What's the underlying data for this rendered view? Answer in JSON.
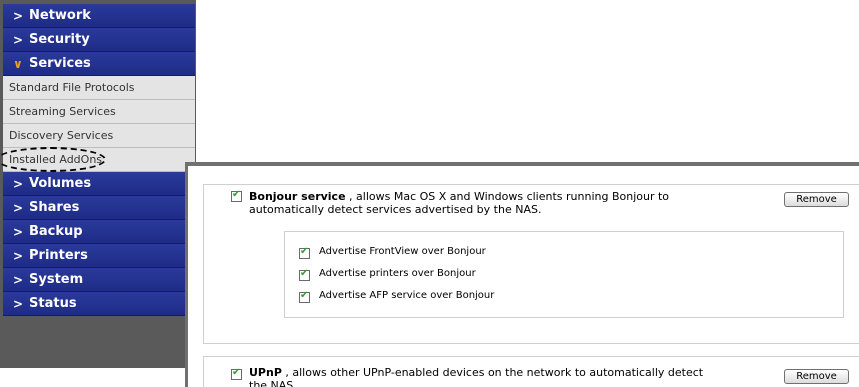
{
  "sidebar": {
    "menu_top": [
      {
        "label": "Network",
        "expanded": false
      },
      {
        "label": "Security",
        "expanded": false
      },
      {
        "label": "Services",
        "expanded": true
      }
    ],
    "submenu": [
      {
        "label": "Standard File Protocols"
      },
      {
        "label": "Streaming Services"
      },
      {
        "label": "Discovery Services",
        "highlighted": true
      },
      {
        "label": "Installed AddOns"
      }
    ],
    "menu_bottom": [
      {
        "label": "Volumes"
      },
      {
        "label": "Shares"
      },
      {
        "label": "Backup"
      },
      {
        "label": "Printers"
      },
      {
        "label": "System"
      },
      {
        "label": "Status"
      }
    ],
    "collapsed_icon": "chevron-right-icon",
    "expanded_icon": "chevron-down-icon",
    "colors": {
      "nav_bg": "#1e2c86",
      "expanded_icon": "#e8a020",
      "submenu_bg": "#e4e4e4"
    }
  },
  "services": [
    {
      "name": "Bonjour service",
      "description": ", allows Mac OS X and Windows clients running Bonjour to automatically detect services advertised by the NAS.",
      "checked": true,
      "remove_label": "Remove",
      "options": [
        {
          "label": "Advertise FrontView over Bonjour",
          "checked": true
        },
        {
          "label": "Advertise printers over Bonjour",
          "checked": true
        },
        {
          "label": "Advertise AFP service over Bonjour",
          "checked": true
        }
      ]
    },
    {
      "name": "UPnP",
      "description": ", allows other UPnP-enabled devices on the network to automatically detect the NAS.",
      "checked": true,
      "remove_label": "Remove"
    }
  ],
  "checkmark_glyph": "✔"
}
